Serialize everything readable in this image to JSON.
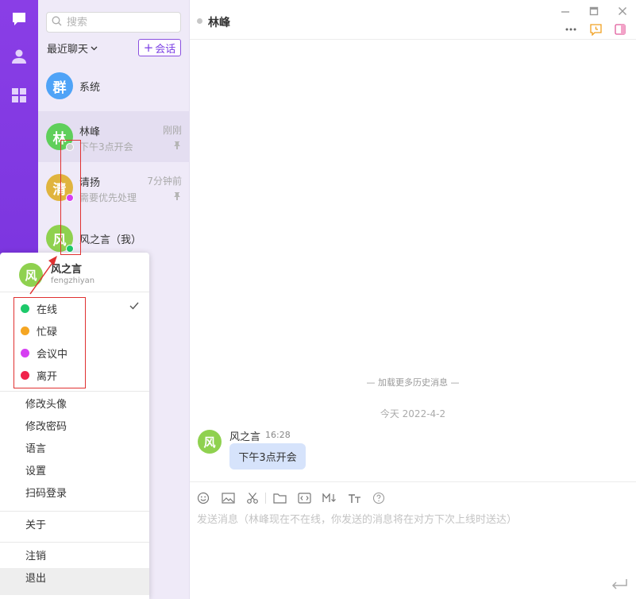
{
  "rail": {
    "items": [
      {
        "name": "chat",
        "icon": "chat-bubble-icon"
      },
      {
        "name": "contacts",
        "icon": "person-icon"
      },
      {
        "name": "apps",
        "icon": "grid-icon"
      }
    ]
  },
  "search": {
    "placeholder": "搜索"
  },
  "filter": {
    "label": "最近聊天"
  },
  "new_chat": {
    "label": "会话"
  },
  "conversations": [
    {
      "avatar_text": "群",
      "avatar_color": "#4fa3f7",
      "name": "系统",
      "time": "",
      "preview": "",
      "status_color": "",
      "pinned": false
    },
    {
      "avatar_text": "林",
      "avatar_color": "#5fcf5b",
      "name": "林峰",
      "time": "刚刚",
      "preview": "下午3点开会",
      "status_color": "#d0d0d0",
      "pinned": true
    },
    {
      "avatar_text": "清",
      "avatar_color": "#e0b43e",
      "name": "清扬",
      "time": "7分钟前",
      "preview": "需要优先处理",
      "status_color": "#d63ff2",
      "pinned": true
    },
    {
      "avatar_text": "风",
      "avatar_color": "#8fd14f",
      "name": "风之言（我）",
      "time": "",
      "preview": "",
      "status_color": "#1dc96a",
      "pinned": false
    }
  ],
  "header": {
    "title": "林峰"
  },
  "chat": {
    "load_more": "— 加载更多历史消息 —",
    "date": "今天 2022-4-2",
    "message": {
      "avatar_text": "风",
      "sender": "风之言",
      "time": "16:28",
      "text": "下午3点开会"
    }
  },
  "input": {
    "placeholder": "发送消息（林峰现在不在线，你发送的消息将在对方下次上线时送达）"
  },
  "popup": {
    "avatar_text": "风",
    "name": "风之言",
    "username": "fengzhiyan",
    "statuses": [
      {
        "label": "在线",
        "color": "#1dc96a",
        "checked": true
      },
      {
        "label": "忙碌",
        "color": "#f5a623",
        "checked": false
      },
      {
        "label": "会议中",
        "color": "#d63ff2",
        "checked": false
      },
      {
        "label": "离开",
        "color": "#f0234b",
        "checked": false
      }
    ],
    "menu": [
      "修改头像",
      "修改密码",
      "语言",
      "设置",
      "扫码登录"
    ],
    "about": "关于",
    "logout": "注销",
    "exit": "退出"
  },
  "colors": {
    "accent": "#7b3fe4",
    "rail_top": "#8a3ee6",
    "rail_bottom": "#6a2bd6",
    "bubble": "#d6e3fb",
    "annotation": "#e03131"
  }
}
